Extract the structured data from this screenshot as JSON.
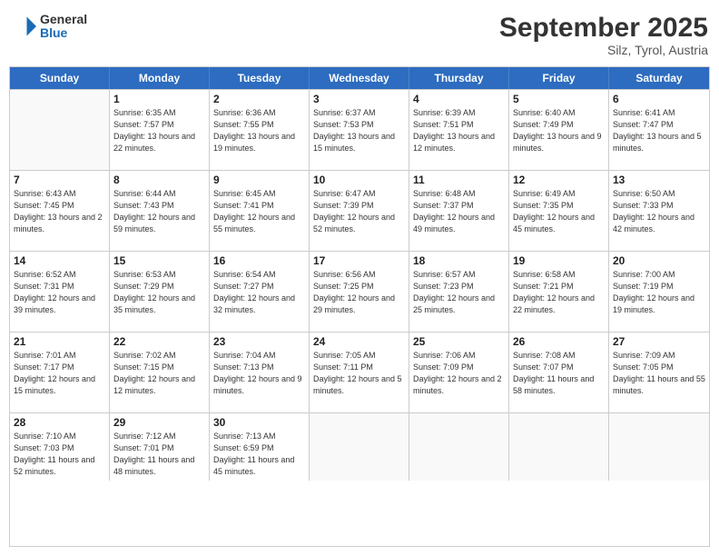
{
  "header": {
    "logo_line1": "General",
    "logo_line2": "Blue",
    "month_title": "September 2025",
    "subtitle": "Silz, Tyrol, Austria"
  },
  "weekdays": [
    "Sunday",
    "Monday",
    "Tuesday",
    "Wednesday",
    "Thursday",
    "Friday",
    "Saturday"
  ],
  "rows": [
    [
      {
        "day": "",
        "empty": true
      },
      {
        "day": "1",
        "sunrise": "6:35 AM",
        "sunset": "7:57 PM",
        "daylight": "13 hours and 22 minutes."
      },
      {
        "day": "2",
        "sunrise": "6:36 AM",
        "sunset": "7:55 PM",
        "daylight": "13 hours and 19 minutes."
      },
      {
        "day": "3",
        "sunrise": "6:37 AM",
        "sunset": "7:53 PM",
        "daylight": "13 hours and 15 minutes."
      },
      {
        "day": "4",
        "sunrise": "6:39 AM",
        "sunset": "7:51 PM",
        "daylight": "13 hours and 12 minutes."
      },
      {
        "day": "5",
        "sunrise": "6:40 AM",
        "sunset": "7:49 PM",
        "daylight": "13 hours and 9 minutes."
      },
      {
        "day": "6",
        "sunrise": "6:41 AM",
        "sunset": "7:47 PM",
        "daylight": "13 hours and 5 minutes."
      }
    ],
    [
      {
        "day": "7",
        "sunrise": "6:43 AM",
        "sunset": "7:45 PM",
        "daylight": "13 hours and 2 minutes."
      },
      {
        "day": "8",
        "sunrise": "6:44 AM",
        "sunset": "7:43 PM",
        "daylight": "12 hours and 59 minutes."
      },
      {
        "day": "9",
        "sunrise": "6:45 AM",
        "sunset": "7:41 PM",
        "daylight": "12 hours and 55 minutes."
      },
      {
        "day": "10",
        "sunrise": "6:47 AM",
        "sunset": "7:39 PM",
        "daylight": "12 hours and 52 minutes."
      },
      {
        "day": "11",
        "sunrise": "6:48 AM",
        "sunset": "7:37 PM",
        "daylight": "12 hours and 49 minutes."
      },
      {
        "day": "12",
        "sunrise": "6:49 AM",
        "sunset": "7:35 PM",
        "daylight": "12 hours and 45 minutes."
      },
      {
        "day": "13",
        "sunrise": "6:50 AM",
        "sunset": "7:33 PM",
        "daylight": "12 hours and 42 minutes."
      }
    ],
    [
      {
        "day": "14",
        "sunrise": "6:52 AM",
        "sunset": "7:31 PM",
        "daylight": "12 hours and 39 minutes."
      },
      {
        "day": "15",
        "sunrise": "6:53 AM",
        "sunset": "7:29 PM",
        "daylight": "12 hours and 35 minutes."
      },
      {
        "day": "16",
        "sunrise": "6:54 AM",
        "sunset": "7:27 PM",
        "daylight": "12 hours and 32 minutes."
      },
      {
        "day": "17",
        "sunrise": "6:56 AM",
        "sunset": "7:25 PM",
        "daylight": "12 hours and 29 minutes."
      },
      {
        "day": "18",
        "sunrise": "6:57 AM",
        "sunset": "7:23 PM",
        "daylight": "12 hours and 25 minutes."
      },
      {
        "day": "19",
        "sunrise": "6:58 AM",
        "sunset": "7:21 PM",
        "daylight": "12 hours and 22 minutes."
      },
      {
        "day": "20",
        "sunrise": "7:00 AM",
        "sunset": "7:19 PM",
        "daylight": "12 hours and 19 minutes."
      }
    ],
    [
      {
        "day": "21",
        "sunrise": "7:01 AM",
        "sunset": "7:17 PM",
        "daylight": "12 hours and 15 minutes."
      },
      {
        "day": "22",
        "sunrise": "7:02 AM",
        "sunset": "7:15 PM",
        "daylight": "12 hours and 12 minutes."
      },
      {
        "day": "23",
        "sunrise": "7:04 AM",
        "sunset": "7:13 PM",
        "daylight": "12 hours and 9 minutes."
      },
      {
        "day": "24",
        "sunrise": "7:05 AM",
        "sunset": "7:11 PM",
        "daylight": "12 hours and 5 minutes."
      },
      {
        "day": "25",
        "sunrise": "7:06 AM",
        "sunset": "7:09 PM",
        "daylight": "12 hours and 2 minutes."
      },
      {
        "day": "26",
        "sunrise": "7:08 AM",
        "sunset": "7:07 PM",
        "daylight": "11 hours and 58 minutes."
      },
      {
        "day": "27",
        "sunrise": "7:09 AM",
        "sunset": "7:05 PM",
        "daylight": "11 hours and 55 minutes."
      }
    ],
    [
      {
        "day": "28",
        "sunrise": "7:10 AM",
        "sunset": "7:03 PM",
        "daylight": "11 hours and 52 minutes."
      },
      {
        "day": "29",
        "sunrise": "7:12 AM",
        "sunset": "7:01 PM",
        "daylight": "11 hours and 48 minutes."
      },
      {
        "day": "30",
        "sunrise": "7:13 AM",
        "sunset": "6:59 PM",
        "daylight": "11 hours and 45 minutes."
      },
      {
        "day": "",
        "empty": true
      },
      {
        "day": "",
        "empty": true
      },
      {
        "day": "",
        "empty": true
      },
      {
        "day": "",
        "empty": true
      }
    ]
  ]
}
